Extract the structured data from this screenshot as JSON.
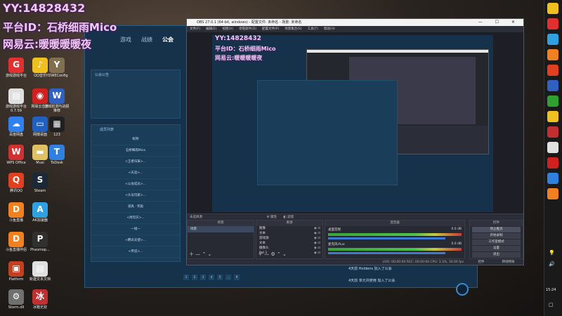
{
  "overlay": {
    "yy": "YY:14828432",
    "platform_id": "平台ID：石桥细雨Mico",
    "netease": "网易云:暖暖暖暖夜"
  },
  "desktop_icons": [
    {
      "label": "游戏游戏平台",
      "color": "#e03030",
      "glyph": "G"
    },
    {
      "label": "QQ音乐",
      "color": "#f0c020",
      "glyph": "♪"
    },
    {
      "label": "YDWEConfig",
      "color": "#807050",
      "glyph": "Y"
    },
    {
      "label": "游戏游戏平台 0.7.59",
      "color": "#e0e0e0",
      "glyph": "▤"
    },
    {
      "label": "网易云音乐",
      "color": "#d02020",
      "glyph": "◉"
    },
    {
      "label": "游戏检测与战报推荐",
      "color": "#3060c0",
      "glyph": "W"
    },
    {
      "label": "百度网盘",
      "color": "#3080f0",
      "glyph": "☁"
    },
    {
      "label": "网媒桌面",
      "color": "#2060c0",
      "glyph": "▭"
    },
    {
      "label": "123",
      "color": "#202020",
      "glyph": "▦"
    },
    {
      "label": "WPS Office",
      "color": "#d03030",
      "glyph": "W"
    },
    {
      "label": "Musi",
      "color": "#e0c060",
      "glyph": "▬"
    },
    {
      "label": "ToDesk",
      "color": "#3080e0",
      "glyph": "T"
    },
    {
      "label": "腾讯QQ",
      "color": "#e04020",
      "glyph": "Q"
    },
    {
      "label": "Steam",
      "color": "#1b2838",
      "glyph": "S"
    },
    {
      "label": "斗鱼直播",
      "color": "#f08020",
      "glyph": "D"
    },
    {
      "label": "AK加速器",
      "color": "#30a0e0",
      "glyph": "A"
    },
    {
      "label": "斗鱼直播伴侣",
      "color": "#f08020",
      "glyph": "D"
    },
    {
      "label": "Phasmop...",
      "color": "#303030",
      "glyph": "P"
    },
    {
      "label": "Platform",
      "color": "#c04020",
      "glyph": "▣"
    },
    {
      "label": "新建文本文档",
      "color": "#e0e0e0",
      "glyph": "▤"
    },
    {
      "label": "Storm.dll",
      "color": "#707070",
      "glyph": "⚙"
    },
    {
      "label": "冰箱无双",
      "color": "#c03030",
      "glyph": "冰"
    }
  ],
  "game": {
    "nav": [
      "游戏",
      "战绩",
      "公会"
    ],
    "notice_title": "公会公告",
    "members_title": "成员列表",
    "rows": [
      "昵称",
      "石桥细雨Mico",
      "<王者归来>...",
      "<天涯>...",
      "<公会成员>...",
      "<头号玩家>...",
      "道具 · 奖励",
      "<周年庆>...",
      "一线一",
      "<腾讯天使>...",
      "<传说>..."
    ],
    "pages": [
      "1",
      "2",
      "3",
      "4",
      "5",
      "...",
      "9"
    ],
    "chat": [
      "4天前 Holdens 加入了公会",
      "4天前 单元共使用 加入了公会"
    ]
  },
  "obs": {
    "title": "OBS 27.0.1 (64-bit, windows) - 配置文件: 未命名 - 场景: 未命名",
    "menu": [
      "文件(F)",
      "编辑(E)",
      "视图(V)",
      "停靠部件(D)",
      "配置文件(P)",
      "场景集合(S)",
      "工具(T)",
      "帮助(H)"
    ],
    "source_label": "未选择源",
    "props_button": "属性",
    "filter_button": "滤镜",
    "docks": {
      "scenes": {
        "title": "场景",
        "items": [
          "场景"
        ]
      },
      "sources": {
        "title": "来源",
        "items": [
          "图像",
          "文本",
          "游戏源",
          "文本",
          "摄像头",
          "Pet 1"
        ]
      },
      "mixer": {
        "title": "混音器",
        "channels": [
          {
            "name": "桌面音频",
            "db": "0.0 dB"
          },
          {
            "name": "麦克风/Aux",
            "db": "0.0 dB"
          }
        ]
      },
      "transitions": {
        "title": "转场特效"
      },
      "controls": {
        "title": "控件",
        "buttons": [
          "停止推流",
          "开始录制",
          "工作室模式",
          "设置",
          "退出"
        ],
        "bottom": [
          "控件",
          "转场特效"
        ]
      }
    },
    "status": "LIVE: 00:00:00   REC: 00:00:00   CPU: 3.3%, 30.00 fps"
  },
  "taskbar": {
    "time": "15:24",
    "icons": [
      "#f0c020",
      "#e03030",
      "#30a0e0",
      "#f08020",
      "#e04020",
      "#3060c0",
      "#30a030",
      "#f0c020",
      "#c03030",
      "#e0e0e0",
      "#d02020",
      "#3080e0",
      "#f08020"
    ]
  },
  "colors": {
    "overlay_text": "#f0c8f0",
    "game_panel": "#16324a",
    "obs_bg": "#2b2e38",
    "stop_stream": "#4a5060"
  }
}
